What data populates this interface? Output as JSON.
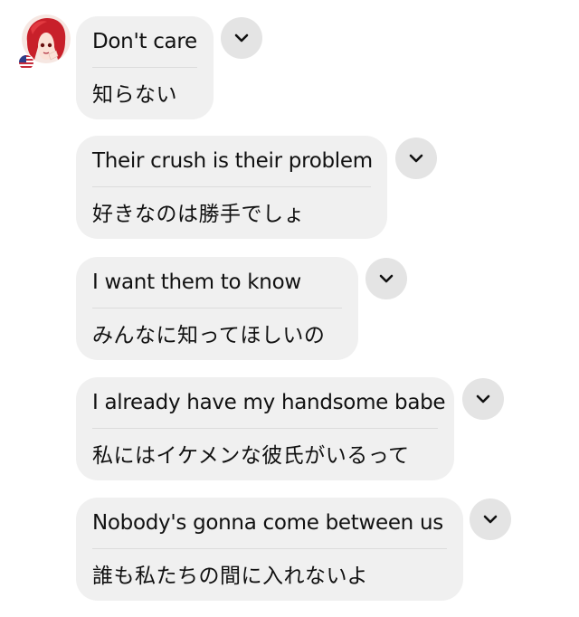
{
  "conversation": {
    "avatar_icon": "user-avatar-anime-red-hair",
    "flag_icon": "us-flag-icon",
    "messages": [
      {
        "original": "Don't care",
        "translation": "知らない"
      },
      {
        "original": "Their crush is their problem",
        "translation": "好きなのは勝手でしょ"
      },
      {
        "original": "I want them to know",
        "translation": "みんなに知ってほしいの"
      },
      {
        "original": "I already have my handsome babe",
        "translation": "私にはイケメンな彼氏がいるって"
      },
      {
        "original": "Nobody's gonna come between us",
        "translation": "誰も私たちの間に入れないよ"
      }
    ],
    "colors": {
      "bubble_bg": "#f0f0f0",
      "chevron_bg": "#e4e4e4",
      "separator": "#dcdcdc",
      "text": "#111111"
    }
  }
}
